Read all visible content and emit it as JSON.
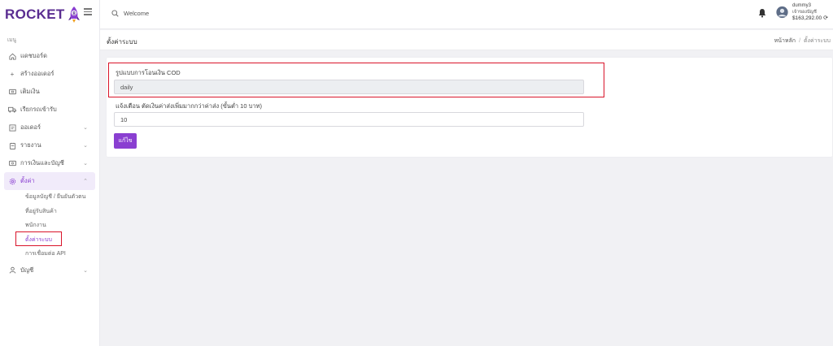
{
  "brand": {
    "word": "ROCKET",
    "badge": "8"
  },
  "sidebar": {
    "caption": "เมนู",
    "items": [
      {
        "label": "แดชบอร์ด",
        "icon": "home-icon"
      },
      {
        "label": "สร้างออเดอร์",
        "icon": "plus-icon"
      },
      {
        "label": "เติมเงิน",
        "icon": "wallet-icon"
      },
      {
        "label": "เรียกรถเข้ารับ",
        "icon": "truck-icon"
      },
      {
        "label": "ออเดอร์",
        "icon": "orders-icon",
        "expandable": true
      },
      {
        "label": "รายงาน",
        "icon": "report-icon",
        "expandable": true
      },
      {
        "label": "การเงินและบัญชี",
        "icon": "finance-icon",
        "expandable": true
      },
      {
        "label": "ตั้งค่า",
        "icon": "gear-icon",
        "expandable": true,
        "active": true
      },
      {
        "label": "บัญชี",
        "icon": "user-icon",
        "expandable": true
      }
    ],
    "settings_sub": [
      "ข้อมูลบัญชี / ยืนยันตัวตน",
      "ที่อยู่รับสินค้า",
      "พนักงาน",
      "ตั้งค่าระบบ",
      "การเชื่อมต่อ API"
    ]
  },
  "header": {
    "search_text": "Welcome",
    "user_name": "dummy3",
    "user_role": "เจ้าของบัญชี",
    "balance": "$163,292.00"
  },
  "page": {
    "title": "ตั้งค่าระบบ",
    "breadcrumb_home": "หน้าหลัก",
    "breadcrumb_sep": "/",
    "breadcrumb_current": "ตั้งค่าระบบ"
  },
  "form": {
    "cod_label": "รูปแบบการโอนเงิน COD",
    "cod_value": "daily",
    "alert_label": "แจ้งเตือน ตัดเงินค่าส่งเพิ่มมากกว่าค่าส่ง (ขั้นต่ำ 10 บาท)",
    "alert_value": "10",
    "submit_label": "แก้ไข"
  },
  "colors": {
    "brand": "#5a2d91",
    "accent": "#8a3fd1",
    "highlight": "#d9142a"
  }
}
